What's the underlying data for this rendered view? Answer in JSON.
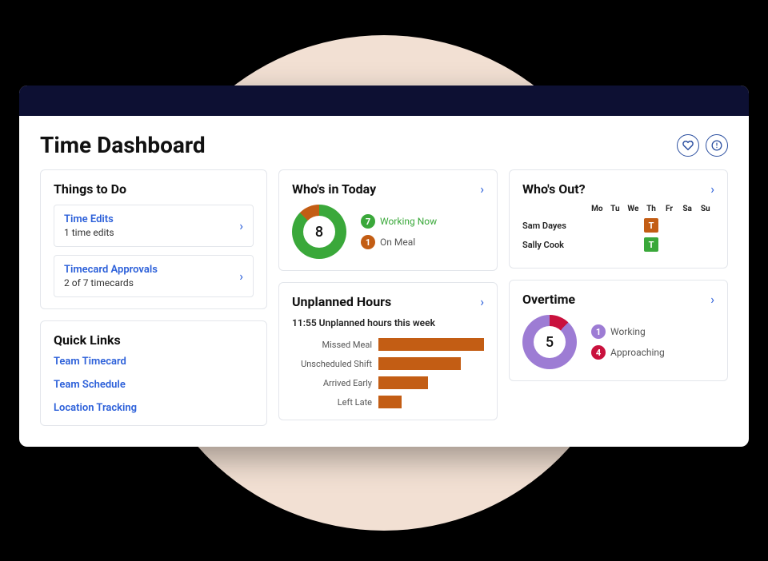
{
  "title": "Time Dashboard",
  "icons": {
    "heart": "heart-icon",
    "alert": "alert-icon"
  },
  "things_to_do": {
    "title": "Things to Do",
    "items": [
      {
        "title": "Time Edits",
        "subtitle": "1 time edits"
      },
      {
        "title": "Timecard Approvals",
        "subtitle": "2 of 7 timecards"
      }
    ]
  },
  "quick_links": {
    "title": "Quick Links",
    "items": [
      {
        "label": "Team Timecard"
      },
      {
        "label": "Team Schedule"
      },
      {
        "label": "Location Tracking"
      }
    ]
  },
  "whos_in": {
    "title": "Who's in Today",
    "total": "8",
    "legend": [
      {
        "count": "7",
        "label": "Working Now",
        "color": "#3aa83a",
        "text_color": "#3aa83a"
      },
      {
        "count": "1",
        "label": "On Meal",
        "color": "#c35d14",
        "text_color": "#555"
      }
    ],
    "donut_style": "conic-gradient(#3aa83a 0 87.5%, #c35d14 87.5% 100%)"
  },
  "unplanned": {
    "title": "Unplanned Hours",
    "subtitle": "11:55 Unplanned hours this week",
    "bars": [
      {
        "label": "Missed Meal",
        "pct": 100
      },
      {
        "label": "Unscheduled Shift",
        "pct": 78
      },
      {
        "label": "Arrived Early",
        "pct": 47
      },
      {
        "label": "Left Late",
        "pct": 22
      }
    ]
  },
  "whos_out": {
    "title": "Who's Out?",
    "days": [
      "Mo",
      "Tu",
      "We",
      "Th",
      "Fr",
      "Sa",
      "Su"
    ],
    "rows": [
      {
        "name": "Sam Dayes",
        "marks": {
          "Th": {
            "letter": "T",
            "color": "#c35d14"
          }
        }
      },
      {
        "name": "Sally Cook",
        "marks": {
          "Th": {
            "letter": "T",
            "color": "#3aa83a"
          }
        }
      }
    ]
  },
  "overtime": {
    "title": "Overtime",
    "total": "5",
    "legend": [
      {
        "count": "1",
        "label": "Working",
        "color": "#9d7cd4",
        "text_color": "#555"
      },
      {
        "count": "4",
        "label": "Approaching",
        "color": "#c9113d",
        "text_color": "#555"
      }
    ],
    "donut_style": "conic-gradient(#c9113d 0 12%, #9d7cd4 12% 100%)"
  },
  "chart_data": [
    {
      "type": "pie",
      "title": "Who's in Today",
      "series": [
        {
          "name": "Working Now",
          "values": [
            7
          ]
        },
        {
          "name": "On Meal",
          "values": [
            1
          ]
        }
      ],
      "total": 8
    },
    {
      "type": "bar",
      "title": "Unplanned Hours",
      "subtitle": "11:55 Unplanned hours this week",
      "categories": [
        "Missed Meal",
        "Unscheduled Shift",
        "Arrived Early",
        "Left Late"
      ],
      "values": [
        100,
        78,
        47,
        22
      ],
      "note": "values are relative bar lengths (percent of max); absolute hours not labeled per-bar"
    },
    {
      "type": "pie",
      "title": "Overtime",
      "series": [
        {
          "name": "Working",
          "values": [
            1
          ]
        },
        {
          "name": "Approaching",
          "values": [
            4
          ]
        }
      ],
      "total": 5
    }
  ]
}
